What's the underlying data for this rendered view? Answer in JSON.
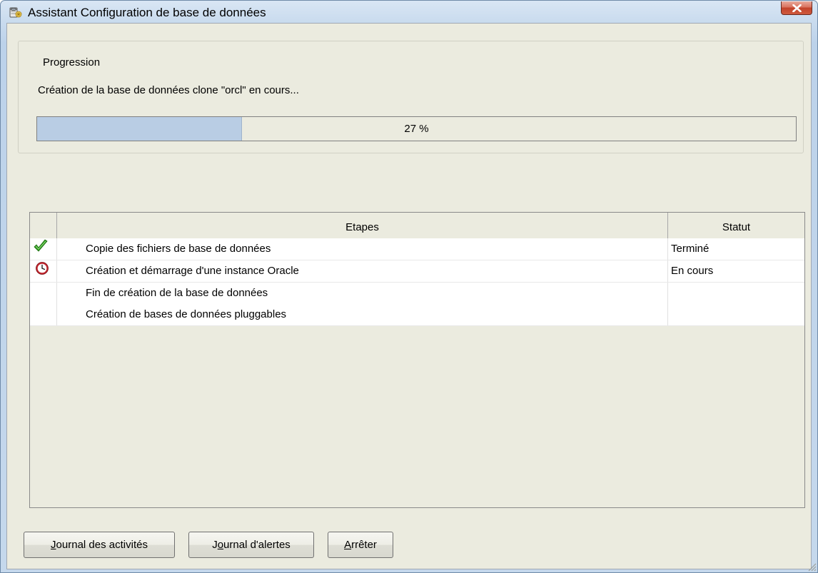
{
  "window": {
    "title": "Assistant Configuration de base de données",
    "app_icon": "database-wizard-icon",
    "close_icon": "close-icon"
  },
  "progress": {
    "legend": "Progression",
    "message": "Création de la base de données clone \"orcl\" en cours...",
    "percent": 27,
    "percent_label": "27 %"
  },
  "steps_table": {
    "headers": {
      "icon": "",
      "steps": "Etapes",
      "status": "Statut"
    },
    "rows": [
      {
        "step": "Copie des fichiers de base de données",
        "status": "Terminé",
        "icon": "checkmark-icon"
      },
      {
        "step": "Création et démarrage d'une instance Oracle",
        "status": "En cours",
        "icon": "clock-icon"
      },
      {
        "step": "Fin de création de la base de données",
        "status": "",
        "icon": ""
      },
      {
        "step": "Création de bases de données pluggables",
        "status": "",
        "icon": ""
      }
    ]
  },
  "buttons": {
    "activities": {
      "mnemonic": "J",
      "rest": "ournal des activités"
    },
    "alerts": {
      "before": "J",
      "mnemonic": "o",
      "rest": "urnal d'alertes"
    },
    "stop": {
      "mnemonic": "A",
      "rest": "rrêter"
    }
  },
  "colors": {
    "progress_fill": "#b9cde4",
    "client_background": "#ebebdf",
    "check_green": "#2d9a1e",
    "clock_red": "#c0242c"
  }
}
